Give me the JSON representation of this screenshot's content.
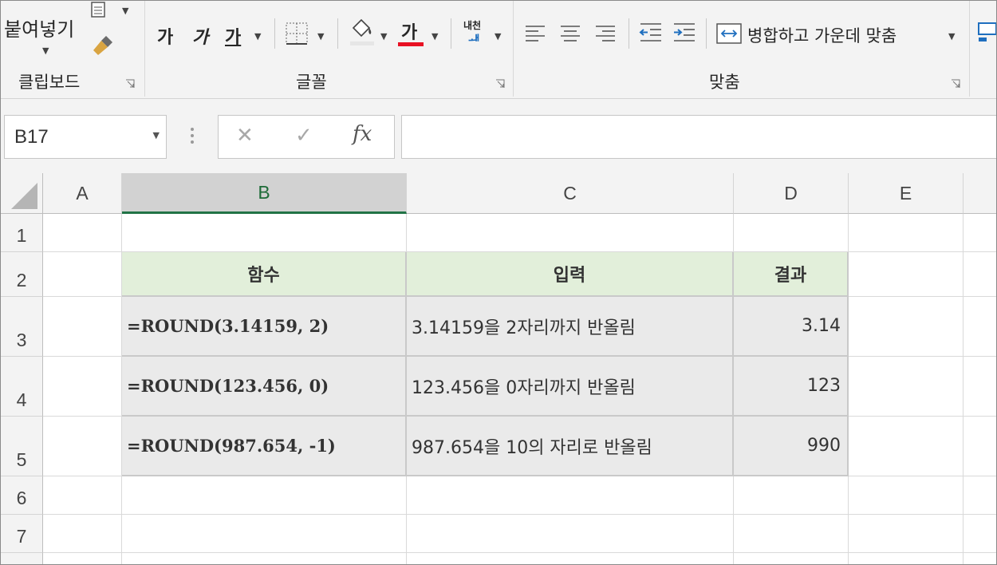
{
  "ribbon": {
    "clipboard": {
      "paste_label": "붙여넣기",
      "group_label": "클립보드"
    },
    "font": {
      "bold_label": "가",
      "italic_label": "가",
      "underline_label": "가",
      "font_color_label": "가",
      "phonetic_label_top": "내천",
      "phonetic_label_bottom": "ᅫ",
      "group_label": "글꼴",
      "font_color": "#e81123"
    },
    "alignment": {
      "merge_center_label": "병합하고 가운데 맞춤",
      "group_label": "맞춤"
    }
  },
  "formula_bar": {
    "name_box_value": "B17",
    "cancel_glyph": "✕",
    "enter_glyph": "✓",
    "fx_label": "fx",
    "formula_value": ""
  },
  "grid": {
    "columns": [
      "A",
      "B",
      "C",
      "D",
      "E"
    ],
    "rows": [
      "1",
      "2",
      "3",
      "4",
      "5",
      "6",
      "7"
    ],
    "selected_column": "B",
    "table": {
      "headers": [
        "함수",
        "입력",
        "결과"
      ],
      "rows": [
        {
          "func": "=ROUND(3.14159, 2)",
          "desc": "3.14159을 2자리까지 반올림",
          "result": "3.14"
        },
        {
          "func": "=ROUND(123.456, 0)",
          "desc": "123.456을 0자리까지 반올림",
          "result": "123"
        },
        {
          "func": "=ROUND(987.654, -1)",
          "desc": "987.654을 10의 자리로 반올림",
          "result": "990"
        }
      ]
    },
    "colors": {
      "header_fill": "#e2efda",
      "data_fill": "#eaeaea",
      "selection_accent": "#217346"
    }
  }
}
